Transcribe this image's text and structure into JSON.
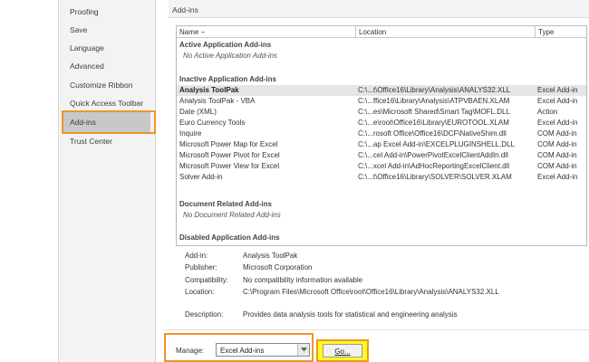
{
  "sidebar": {
    "items": [
      {
        "label": "Proofing"
      },
      {
        "label": "Save"
      },
      {
        "label": "Language"
      },
      {
        "label": "Advanced"
      },
      {
        "label": "Customize Ribbon"
      },
      {
        "label": "Quick Access Toolbar"
      },
      {
        "label": "Add-ins",
        "selected": true
      },
      {
        "label": "Trust Center"
      }
    ]
  },
  "section": {
    "title": "Add-ins"
  },
  "list": {
    "columns": {
      "name": "Name −",
      "location": "Location",
      "type": "Type"
    },
    "groups": {
      "active": {
        "title": "Active Application Add-ins",
        "empty": "No Active Application Add-ins"
      },
      "inactive": {
        "title": "Inactive Application Add-ins"
      },
      "document": {
        "title": "Document Related Add-ins",
        "empty": "No Document Related Add-ins"
      },
      "disabled": {
        "title": "Disabled Application Add-ins"
      }
    },
    "rows": [
      {
        "name": "Analysis ToolPak",
        "location": "C:\\...t\\Office16\\Library\\Analysis\\ANALYS32.XLL",
        "type": "Excel Add-in",
        "selected": true
      },
      {
        "name": "Analysis ToolPak - VBA",
        "location": "C:\\...ffice16\\Library\\Analysis\\ATPVBAEN.XLAM",
        "type": "Excel Add-in"
      },
      {
        "name": "Date (XML)",
        "location": "C:\\...es\\Microsoft Shared\\Smart Tag\\MOFL.DLL",
        "type": "Action"
      },
      {
        "name": "Euro Currency Tools",
        "location": "C:\\...e\\root\\Office16\\Library\\EUROTOOL.XLAM",
        "type": "Excel Add-in"
      },
      {
        "name": "Inquire",
        "location": "C:\\...rosoft Office\\Office16\\DCF\\NativeShim.dll",
        "type": "COM Add-in"
      },
      {
        "name": "Microsoft Power Map for Excel",
        "location": "C:\\...ap Excel Add-in\\EXCELPLUGINSHELL.DLL",
        "type": "COM Add-in"
      },
      {
        "name": "Microsoft Power Pivot for Excel",
        "location": "C:\\...cel Add-in\\PowerPivotExcelClientAddIn.dll",
        "type": "COM Add-in"
      },
      {
        "name": "Microsoft Power View for Excel",
        "location": "C:\\...xcel Add-in\\AdHocReportingExcelClient.dll",
        "type": "COM Add-in"
      },
      {
        "name": "Solver Add-in",
        "location": "C:\\...t\\Office16\\Library\\SOLVER\\SOLVER.XLAM",
        "type": "Excel Add-in"
      }
    ]
  },
  "details": {
    "addin_label": "Add-in:",
    "addin_value": "Analysis ToolPak",
    "publisher_label": "Publisher:",
    "publisher_value": "Microsoft Corporation",
    "compat_label": "Compatibility:",
    "compat_value": "No compatibility information available",
    "location_label": "Location:",
    "location_value": "C:\\Program Files\\Microsoft Office\\root\\Office16\\Library\\Analysis\\ANALYS32.XLL",
    "desc_label": "Description:",
    "desc_value": "Provides data analysis tools for statistical and engineering analysis"
  },
  "manage": {
    "label": "Manage:",
    "selected": "Excel Add-ins",
    "go_label": "Go..."
  },
  "colors": {
    "highlight": "#f0942a",
    "go_highlight": "#fffd1a",
    "selection": "#e5e5e5"
  },
  "icons": {
    "dropdown": "chevron-down-icon"
  }
}
